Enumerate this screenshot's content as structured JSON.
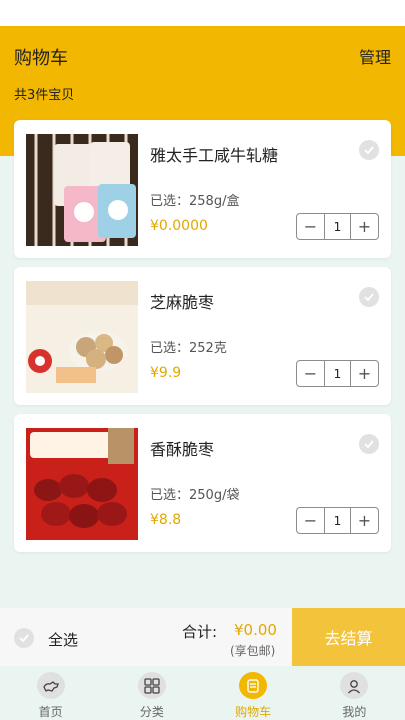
{
  "header": {
    "title": "购物车",
    "manage_label": "管理",
    "count_text": "共3件宝贝"
  },
  "items": [
    {
      "name": "雅太手工咸牛轧糖",
      "spec": "已选：258g/盒",
      "price": "¥0.0000",
      "qty": "1"
    },
    {
      "name": "芝麻脆枣",
      "spec": "已选：252克",
      "price": "¥9.9",
      "qty": "1"
    },
    {
      "name": "香酥脆枣",
      "spec": "已选：250g/袋",
      "price": "¥8.8",
      "qty": "1"
    }
  ],
  "bottom": {
    "select_all_label": "全选",
    "total_label": "合计:",
    "total_value": "¥0.00",
    "shipping_note": "(享包邮)",
    "checkout_label": "去结算"
  },
  "tabs": [
    {
      "label": "首页",
      "icon": "dog-icon"
    },
    {
      "label": "分类",
      "icon": "grid-icon"
    },
    {
      "label": "购物车",
      "icon": "cart-icon"
    },
    {
      "label": "我的",
      "icon": "user-icon"
    }
  ],
  "colors": {
    "accent": "#f2b701",
    "price": "#e0a800",
    "checkout": "#f3c43b"
  }
}
